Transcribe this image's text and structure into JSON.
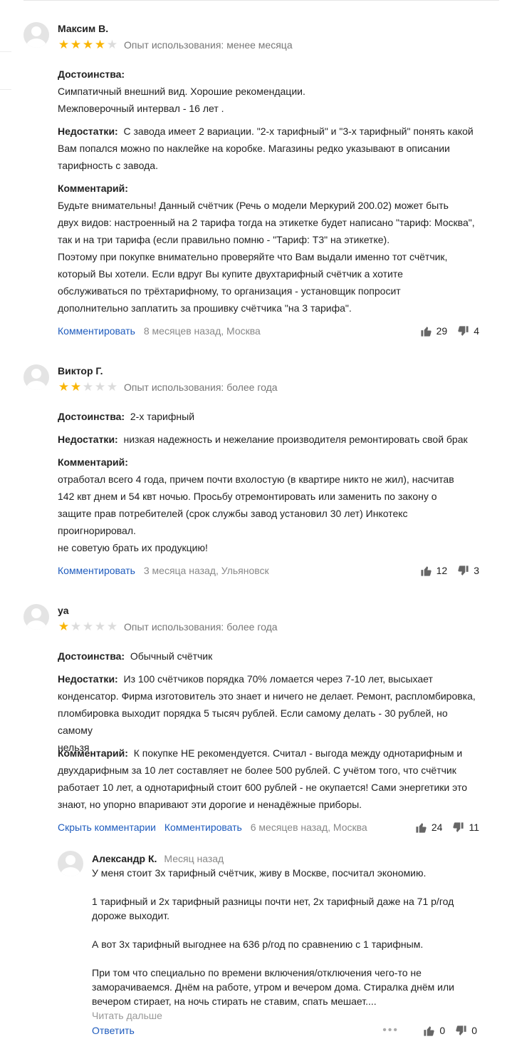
{
  "reviews": [
    {
      "author": "Максим В.",
      "stars": [
        true,
        true,
        true,
        true,
        false
      ],
      "experience": "Опыт использования: менее месяца",
      "pros_label": "Достоинства:",
      "pros": "Симпатичный внешний вид. Хорошие рекомендации.\nМежповерочный интервал - 16 лет .",
      "cons_label": "Недостатки:",
      "cons": "С завода имеет 2 вариации. \"2-х тарифный\" и \"3-х тарифный\" понять какой\nВам попался можно по наклейке на коробке. Магазины редко указывают в описании\nтарифность с завода.",
      "comment_label": "Комментарий:",
      "comment": "Будьте внимательны! Данный счётчик (Речь о модели Меркурий 200.02) может быть\nдвух видов: настроенный на 2 тарифа тогда на этикетке будет написано \"тариф: Москва\",\nтак и на три тарифа (если правильно помню - \"Тариф: Т3\" на этикетке).\nПоэтому при покупке внимательно проверяйте что Вам выдали именно тот счётчик,\nкоторый Вы хотели. Если вдруг Вы купите двухтарифный счётчик а хотите\nобслуживаться по трёхтарифному, то организация - установщик попросит\nдополнительно заплатить за прошивку счётчика \"на 3 тарифа\".",
      "comment_link": "Комментировать",
      "meta": "8 месяцев назад, Москва",
      "likes": "29",
      "dislikes": "4"
    },
    {
      "author": "Виктор Г.",
      "stars": [
        true,
        true,
        false,
        false,
        false
      ],
      "experience": "Опыт использования: более года",
      "pros_label": "Достоинства:",
      "pros": "2-х тарифный",
      "cons_label": "Недостатки:",
      "cons": "низкая надежность и нежелание производителя ремонтировать свой брак",
      "comment_label": "Комментарий:",
      "comment": "отработал всего 4 года, причем почти вхолостую (в квартире никто не жил), насчитав\n142 квт днем и 54 квт ночью. Просьбу отремонтировать или заменить по закону о\nзащите прав потребителей (срок службы завод установил 30 лет) Инкотекс\nпроигнорировал.\nне советую брать их продукцию!",
      "comment_link": "Комментировать",
      "meta": "3 месяца назад, Ульяновск",
      "likes": "12",
      "dislikes": "3"
    },
    {
      "author": "ya",
      "stars": [
        true,
        false,
        false,
        false,
        false
      ],
      "experience": "Опыт использования: более года",
      "pros_label": "Достоинства:",
      "pros": "Обычный счётчик",
      "cons_label": "Недостатки:",
      "cons": "Из 100 счётчиков порядка 70% ломается через 7-10 лет, высыхает\nконденсатор. Фирма изготовитель это знает и ничего не делает. Ремонт, распломбировка,\nпломбировка выходит порядка 5 тысяч рублей. Если самому делать - 30 рублей, но самому\nнельзя",
      "comment_label": "Комментарий:",
      "comment": "К покупке НЕ рекомендуется. Считал - выгода между однотарифным и\nдвухдарифным за 10 лет составляет не более 500 рублей. С учётом того, что счётчик\nработает 10 лет, а однотарифный стоит 600 рублей - не окупается! Сами энергетики это\nзнают, но упорно впаривают эти дорогие и ненадёжные приборы.",
      "hide_link": "Скрыть комментарии",
      "comment_link": "Комментировать",
      "meta": "6 месяцев назад, Москва",
      "likes": "24",
      "dislikes": "11"
    }
  ],
  "reply": {
    "author": "Александр К.",
    "time": "Месяц назад",
    "text": "У меня стоит 3х тарифный счётчик, живу в Москве, посчитал экономию.\n\n1 тарифный и 2х тарифный разницы почти нет, 2х тарифный даже на 71 р/год\nдороже выходит.\n\nА вот 3х тарифный выгоднее на 636 р/год по сравнению с 1 тарифным.\n\nПри том что специально по времени включения/отключения чего-то не\nзаморачиваемся. Днём на работе, утром и вечером дома. Стиралка днём или\nвечером стирает, на ночь стирать не ставим, спать мешает....",
    "read_more": "Читать дальше",
    "answer_link": "Ответить",
    "more_dots": "•••",
    "likes": "0",
    "dislikes": "0"
  }
}
